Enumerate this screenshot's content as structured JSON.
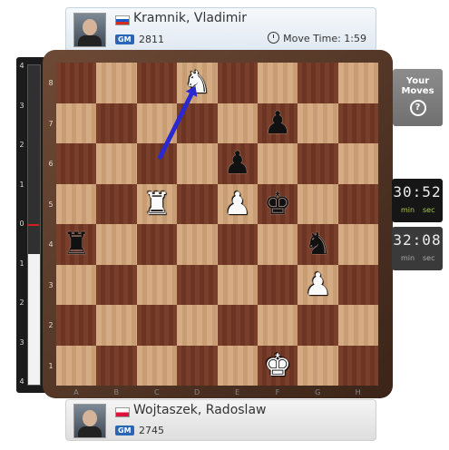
{
  "players": {
    "top": {
      "name": "Kramnik, Vladimir",
      "title": "GM",
      "rating": "2811",
      "flag": "russia-flag",
      "move_time_label": "Move Time: 1:59"
    },
    "bottom": {
      "name": "Wojtaszek, Radoslaw",
      "title": "GM",
      "rating": "2745",
      "flag": "poland-flag"
    }
  },
  "eval_bar": {
    "labels": [
      "4",
      "3",
      "2",
      "1",
      "0",
      "1",
      "2",
      "3",
      "4"
    ],
    "white_fraction": 0.41
  },
  "board": {
    "ranks": [
      "8",
      "7",
      "6",
      "5",
      "4",
      "3",
      "2",
      "1"
    ],
    "files": [
      "A",
      "B",
      "C",
      "D",
      "E",
      "F",
      "G",
      "H"
    ],
    "pieces": [
      {
        "square": "d8",
        "type": "knight",
        "color": "white",
        "glyph": "♞"
      },
      {
        "square": "f7",
        "type": "pawn",
        "color": "black",
        "glyph": "♟"
      },
      {
        "square": "e6",
        "type": "pawn",
        "color": "black",
        "glyph": "♟"
      },
      {
        "square": "c5",
        "type": "rook",
        "color": "white",
        "glyph": "♜"
      },
      {
        "square": "e5",
        "type": "pawn",
        "color": "white",
        "glyph": "♟"
      },
      {
        "square": "f5",
        "type": "king",
        "color": "black",
        "glyph": "♚"
      },
      {
        "square": "a4",
        "type": "rook",
        "color": "black",
        "glyph": "♜"
      },
      {
        "square": "g4",
        "type": "knight",
        "color": "black",
        "glyph": "♞"
      },
      {
        "square": "g3",
        "type": "pawn",
        "color": "white",
        "glyph": "♟"
      },
      {
        "square": "f1",
        "type": "king",
        "color": "white",
        "glyph": "♚"
      }
    ],
    "arrow": {
      "from": "c6",
      "to": "d8",
      "color": "#2a2ad0"
    }
  },
  "side_panel": {
    "your_moves_label_1": "Your",
    "your_moves_label_2": "Moves",
    "help_glyph": "?"
  },
  "clocks": {
    "top": {
      "time": "30:52",
      "min_label": "min",
      "sec_label": "sec"
    },
    "bottom": {
      "time": "32:08",
      "min_label": "min",
      "sec_label": "sec"
    }
  }
}
